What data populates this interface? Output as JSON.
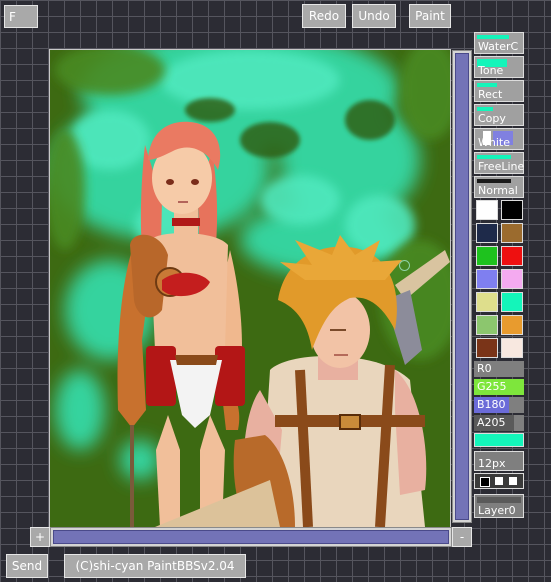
{
  "top_buttons": {
    "f": "F",
    "redo": "Redo",
    "undo": "Undo",
    "paint": "Paint"
  },
  "tools": [
    {
      "label": "WaterC",
      "bar_color": "#14f5ba"
    },
    {
      "label": "Tone",
      "bar_color": "#14f5ba"
    },
    {
      "label": "Rect",
      "bar_color": "#14f5ba"
    },
    {
      "label": "Copy",
      "bar_color": "#14f5ba"
    },
    {
      "label": "White",
      "bar_color": "#8080e0"
    },
    {
      "label": "FreeLine",
      "bar_color": "#14f5ba"
    },
    {
      "label": "Normal",
      "bar_color": "#1a1a1a"
    }
  ],
  "palette": [
    "#ffffff",
    "#000000",
    "#1e2a4a",
    "#9b6b2e",
    "#1ec21e",
    "#ee1010",
    "#7f7ff0",
    "#f4aaf0",
    "#dede8c",
    "#14f5ba",
    "#8cc66e",
    "#e89b2e",
    "#7a3418",
    "#f8e8e0"
  ],
  "sliders": [
    {
      "label": "R0",
      "value": 0,
      "color": "#505050"
    },
    {
      "label": "G255",
      "value": 255,
      "color": "#7ee63c"
    },
    {
      "label": "B180",
      "value": 180,
      "color": "#6b6bd8"
    },
    {
      "label": "A205",
      "value": 205,
      "color": "#5a5a5a"
    }
  ],
  "current_color": "#14f5ba",
  "brush_size_label": "12px",
  "layer_label": "Layer0",
  "plus_label": "+",
  "minus_label": "-",
  "send_label": "Send",
  "credit_label": "(C)shi-cyan PaintBBSv2.04"
}
